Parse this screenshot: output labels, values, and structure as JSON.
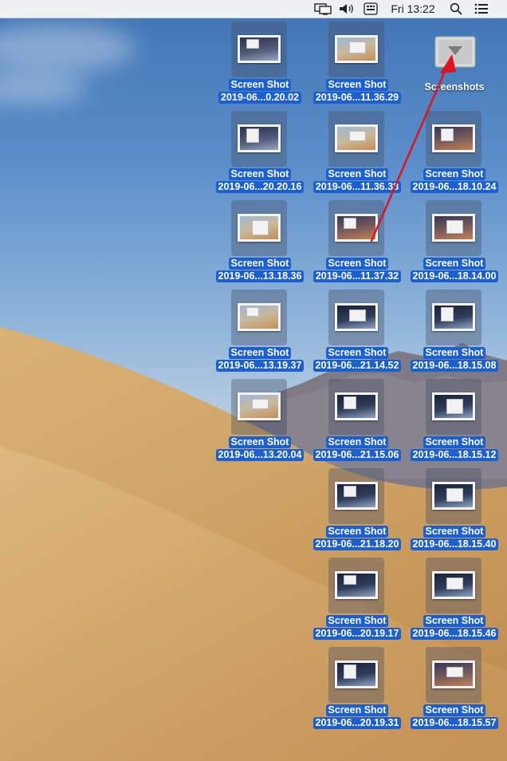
{
  "menubar": {
    "clock": "Fri 13:22",
    "icons": [
      "display-mirroring-icon",
      "volume-icon",
      "input-menu-icon",
      "search-icon",
      "notification-center-icon"
    ]
  },
  "desktop": {
    "folder": {
      "label": "Screenshots",
      "icon": "folder-icon"
    },
    "files": [
      {
        "line1": "Screen Shot",
        "line2": "2019-06...0.20.02"
      },
      {
        "line1": "Screen Shot",
        "line2": "2019-06...11.36.29"
      },
      {
        "line1": "Screen Shot",
        "line2": "2019-06...20.20.16"
      },
      {
        "line1": "Screen Shot",
        "line2": "2019-06...11.36.38"
      },
      {
        "line1": "Screen Shot",
        "line2": "2019-06...18.10.24"
      },
      {
        "line1": "Screen Shot",
        "line2": "2019-06...13.18.36"
      },
      {
        "line1": "Screen Shot",
        "line2": "2019-06...11.37.32"
      },
      {
        "line1": "Screen Shot",
        "line2": "2019-06...18.14.00"
      },
      {
        "line1": "Screen Shot",
        "line2": "2019-06...13.19.37"
      },
      {
        "line1": "Screen Shot",
        "line2": "2019-06...21.14.52"
      },
      {
        "line1": "Screen Shot",
        "line2": "2019-06...18.15.08"
      },
      {
        "line1": "Screen Shot",
        "line2": "2019-06...13.20.04"
      },
      {
        "line1": "Screen Shot",
        "line2": "2019-06...21.15.06"
      },
      {
        "line1": "Screen Shot",
        "line2": "2019-06...18.15.12"
      },
      {
        "line1": "Screen Shot",
        "line2": "2019-06...21.18.20"
      },
      {
        "line1": "Screen Shot",
        "line2": "2019-06...18.15.40"
      },
      {
        "line1": "Screen Shot",
        "line2": "2019-06...20.19.17"
      },
      {
        "line1": "Screen Shot",
        "line2": "2019-06...18.15.46"
      },
      {
        "line1": "Screen Shot",
        "line2": "2019-06...20.19.31"
      },
      {
        "line1": "Screen Shot",
        "line2": "2019-06...18.15.57"
      }
    ]
  },
  "colors": {
    "selection": "#1b5fd0",
    "annotation_arrow": "#e0141e"
  }
}
